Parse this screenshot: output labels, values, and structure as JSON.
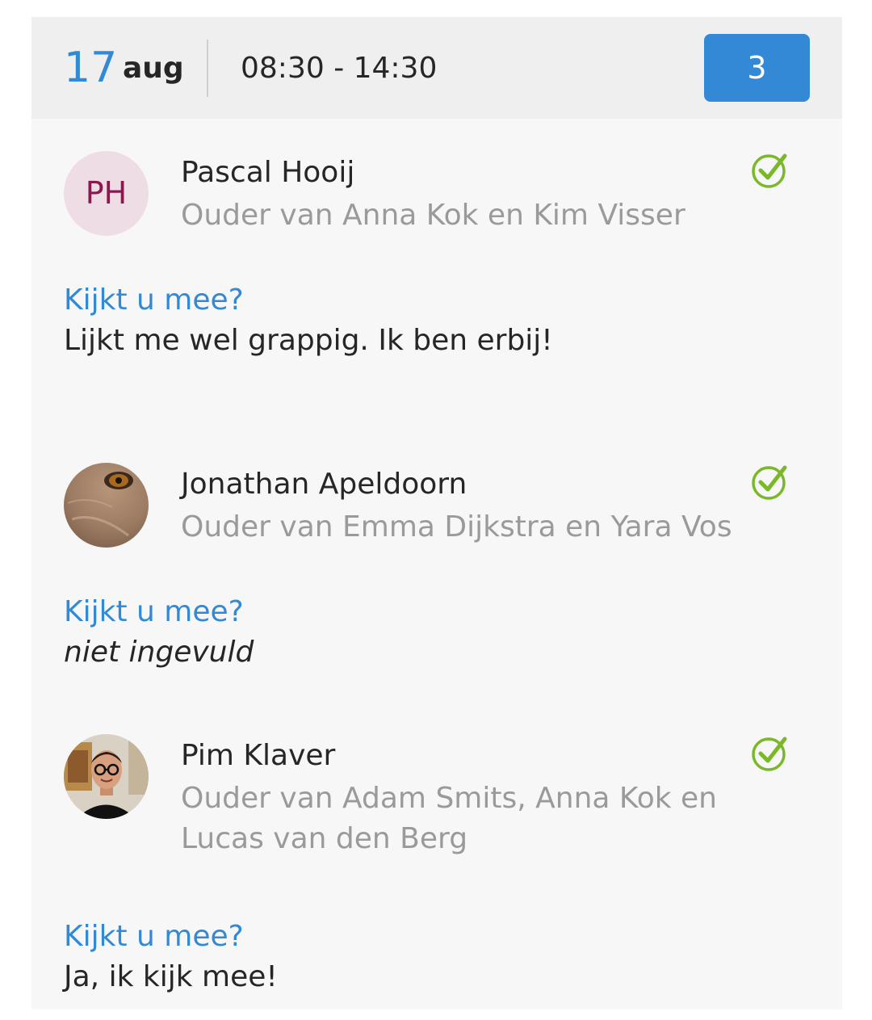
{
  "header": {
    "day": "17",
    "month": "aug",
    "time": "08:30 - 14:30",
    "count": "3"
  },
  "colors": {
    "accent": "#3489d6",
    "check": "#7ab82a",
    "muted": "#9a9a9a",
    "initials_bg": "#efdde6",
    "initials_fg": "#8a1a4e"
  },
  "entries": [
    {
      "name": "Pascal Hooij",
      "initials": "PH",
      "avatar": "initials",
      "subtitle": "Ouder van Anna Kok en Kim Visser",
      "status_icon": "check-circle-icon",
      "question": "Kijkt u mee?",
      "answer": "Lijkt me wel grappig. Ik ben erbij!"
    },
    {
      "name": "Jonathan Apeldoorn",
      "avatar": "photo-eye",
      "subtitle": "Ouder van Emma Dijkstra en Yara Vos",
      "status_icon": "check-circle-icon",
      "question": "Kijkt u mee?",
      "answer": "niet ingevuld"
    },
    {
      "name": "Pim Klaver",
      "avatar": "photo-person",
      "subtitle": "Ouder van Adam Smits, Anna Kok en Lucas van den Berg",
      "status_icon": "check-circle-icon",
      "question": "Kijkt u mee?",
      "answer": "Ja, ik kijk mee!"
    }
  ]
}
